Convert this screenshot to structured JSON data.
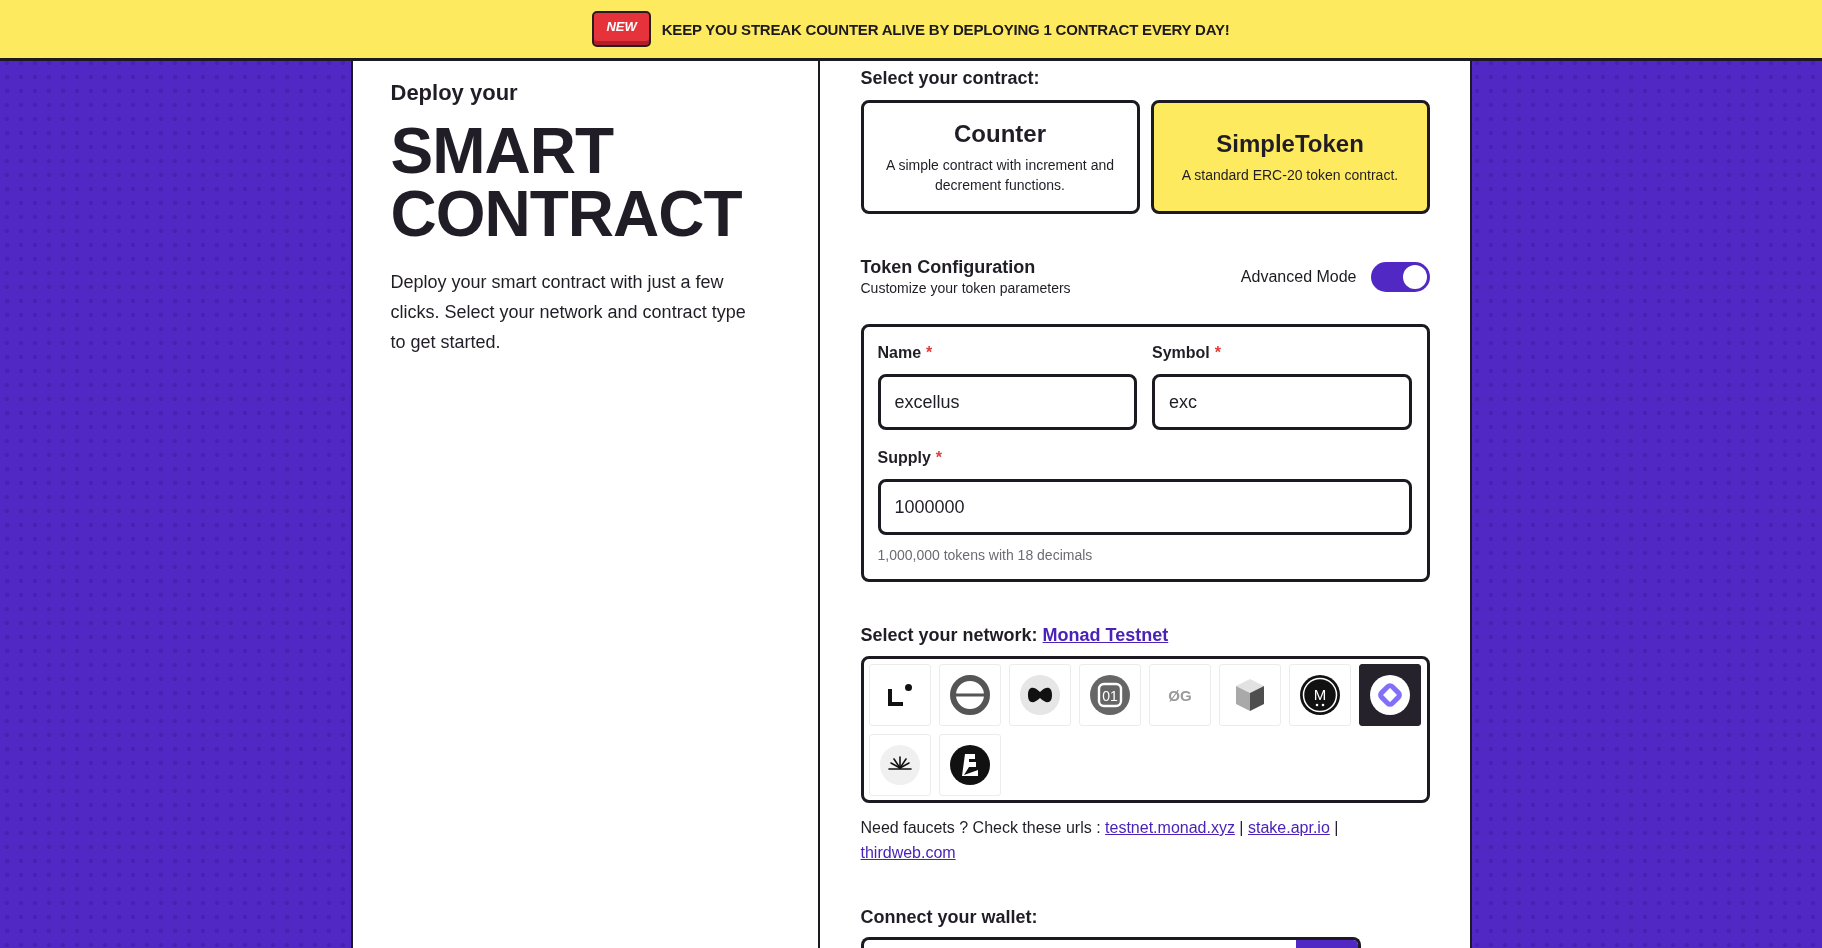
{
  "banner": {
    "badge": "NEW",
    "text": "KEEP YOU STREAK COUNTER ALIVE BY DEPLOYING 1 CONTRACT EVERY DAY!"
  },
  "intro": {
    "kicker": "Deploy your",
    "title": "SMART CONTRACT",
    "description": "Deploy your smart contract with just a few clicks. Select your network and contract type to get started."
  },
  "contract_picker": {
    "label": "Select your contract:",
    "options": [
      {
        "title": "Counter",
        "description": "A simple contract with increment and decrement functions.",
        "selected": false
      },
      {
        "title": "SimpleToken",
        "description": "A standard ERC-20 token contract.",
        "selected": true
      }
    ]
  },
  "token_config": {
    "title": "Token Configuration",
    "subtitle": "Customize your token parameters",
    "advanced_mode": {
      "label": "Advanced Mode",
      "on": true
    },
    "fields": [
      {
        "label": "Name",
        "required_mark": "*",
        "value": "excellus"
      },
      {
        "label": "Symbol",
        "required_mark": "*",
        "value": "exc"
      },
      {
        "label": "Supply",
        "required_mark": "*",
        "value": "1000000",
        "hint": "1,000,000 tokens with 18 decimals"
      }
    ]
  },
  "network": {
    "label": "Select your network:",
    "current": "Monad Testnet",
    "options": [
      {
        "kind": "corner",
        "selected": false
      },
      {
        "kind": "ring",
        "selected": false
      },
      {
        "kind": "bowtie",
        "selected": false
      },
      {
        "kind": "numeral",
        "glyph": "01",
        "selected": false
      },
      {
        "kind": "wordmark",
        "glyph": "ØG",
        "selected": false
      },
      {
        "kind": "cube",
        "selected": false
      },
      {
        "kind": "letter",
        "glyph": "M",
        "selected": false
      },
      {
        "kind": "diamond",
        "selected": true
      },
      {
        "kind": "sunburst",
        "selected": false
      },
      {
        "kind": "steps",
        "selected": false
      }
    ]
  },
  "faucets": {
    "text": "Need faucets ? Check these urls :",
    "separator": "|",
    "links": [
      "testnet.monad.xyz",
      "stake.apr.io",
      "thirdweb.com"
    ]
  },
  "wallet": {
    "label": "Connect your wallet:"
  }
}
